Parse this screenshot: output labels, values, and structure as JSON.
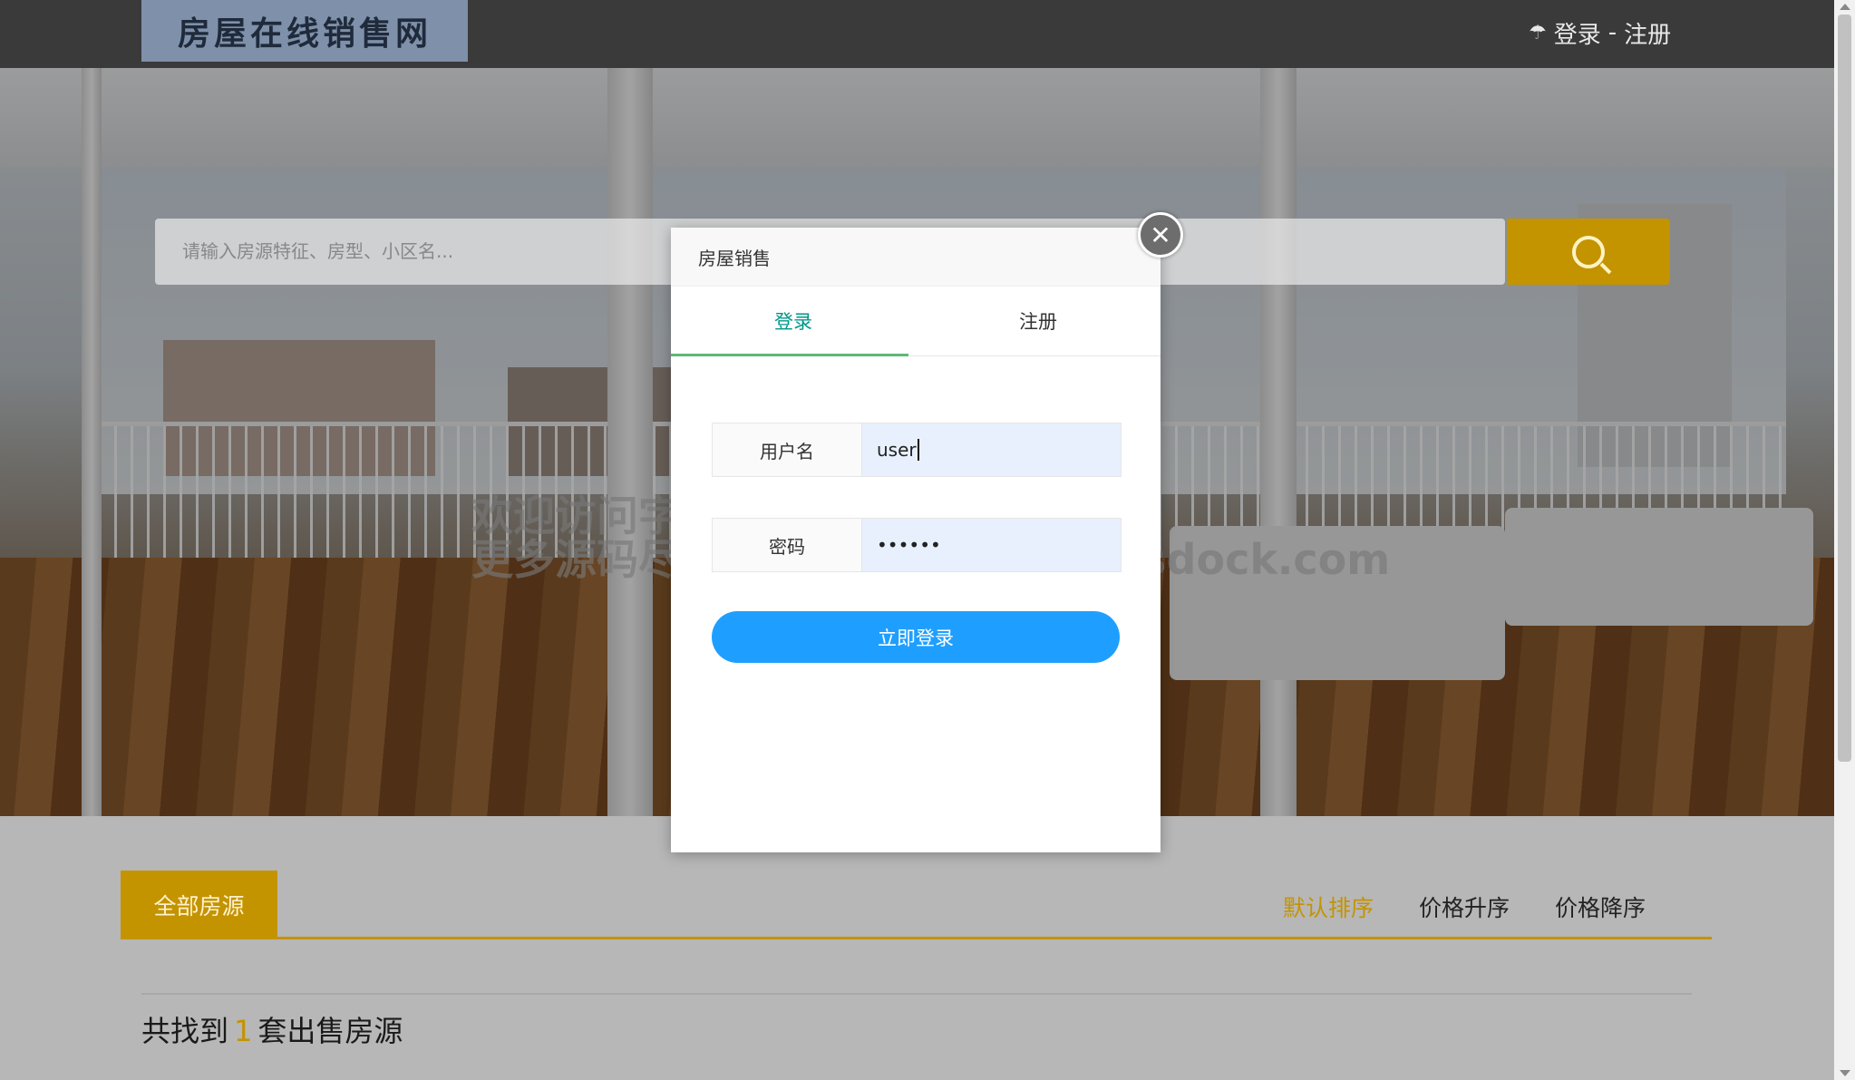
{
  "header": {
    "logo_text": "房屋在线销售网",
    "user_icon": "user-icon",
    "login_link": "登录",
    "separator": "-",
    "register_link": "注册"
  },
  "search": {
    "placeholder": "请输入房源特征、房型、小区名...",
    "button_icon": "search-icon"
  },
  "listing": {
    "category_tab": "全部房源",
    "sort_options": [
      "默认排序",
      "价格升序",
      "价格降序"
    ],
    "active_sort": "默认排序",
    "result_prefix": "共找到",
    "result_count": "1",
    "result_suffix": "套出售房源"
  },
  "modal": {
    "title": "房屋销售",
    "close_icon": "close-icon",
    "tabs": [
      "登录",
      "注册"
    ],
    "active_tab": "登录",
    "username_label": "用户名",
    "username_value": "user",
    "password_label": "密码",
    "password_value": "••••••",
    "submit_label": "立即登录"
  },
  "watermark": {
    "line1": "欢迎访问字节码头",
    "line2": "更多源码尽在  https://www.bytesdock.com"
  },
  "colors": {
    "accent": "#c49300",
    "primary_button": "#1e9fff",
    "tab_active": "#009688",
    "header_bg": "#3a3a3a"
  }
}
